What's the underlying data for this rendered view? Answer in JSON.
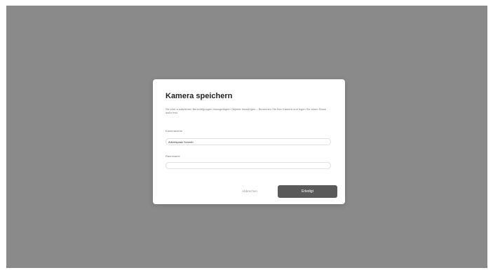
{
  "dialog": {
    "title": "Kamera speichern",
    "description": "Sie sind zusätzlichen Berechtigungen hinzugefügten Objekte hinzufügen – Benennen Sie Ihre Kamera und legen Sie einen Raum dafür fest.",
    "name_field": {
      "label": "Kameraname",
      "value": "Arbeitsplatz Schreib"
    },
    "room_field": {
      "label": "Raumname",
      "value": ""
    },
    "cancel_label": "Abbrechen",
    "create_label": "Erledigt"
  }
}
